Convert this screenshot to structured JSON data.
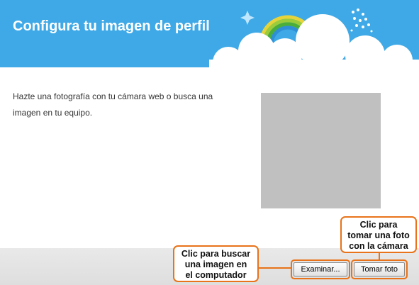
{
  "header": {
    "title": "Configura tu imagen de perfil",
    "background_color": "#3ea9e6"
  },
  "decorations": {
    "icons": [
      "rainbow-icon",
      "cloud-icon",
      "sparkle-star-icon",
      "sparkle-dots-icon"
    ]
  },
  "content": {
    "instructions_line1": "Hazte una fotografía con tu cámara web o busca una",
    "instructions_line2": "imagen en tu equipo.",
    "preview_color": "#c0c0c0"
  },
  "footer": {
    "browse_label": "Examinar...",
    "take_photo_label": "Tomar foto"
  },
  "callouts": {
    "browse_line1": "Clic para buscar",
    "browse_line2": "una imagen en",
    "browse_line3": "el computador",
    "take_line1": "Clic para",
    "take_line2": "tomar una foto",
    "take_line3": "con la cámara",
    "accent_color": "#e8731a"
  }
}
